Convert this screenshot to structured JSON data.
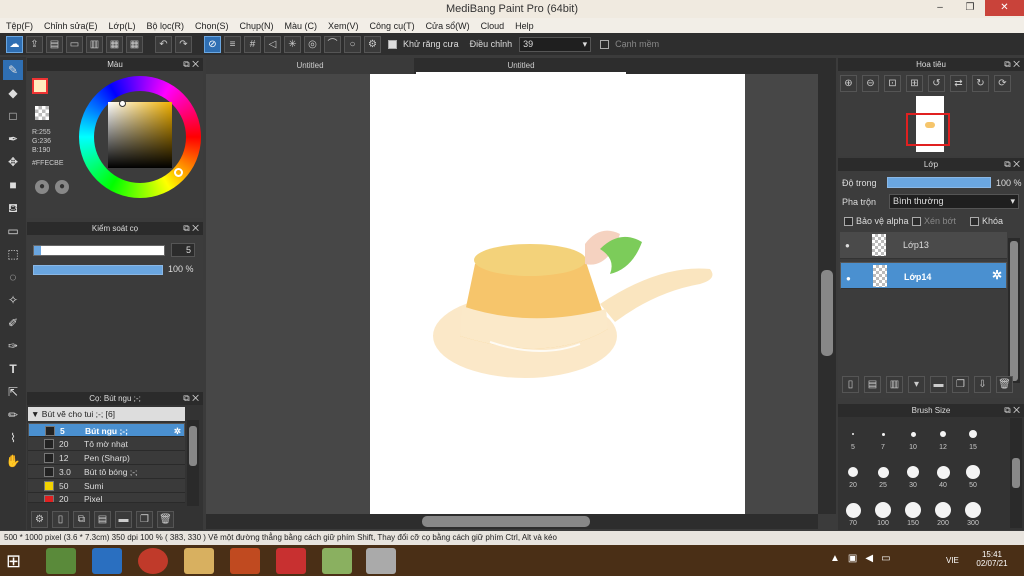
{
  "window": {
    "title": "MediBang Paint Pro (64bit)",
    "minimize": "–",
    "restore": "❐",
    "close": "✕"
  },
  "menu": [
    "Tệp(F)",
    "Chỉnh sửa(E)",
    "Lớp(L)",
    "Bộ lọc(R)",
    "Chọn(S)",
    "Chụp(N)",
    "Màu (C)",
    "Xem(V)",
    "Công cụ(T)",
    "Cửa sổ(W)",
    "Cloud",
    "Help"
  ],
  "toolbar": {
    "antialias_label": "Khử răng cưa",
    "correction_label": "Điều chỉnh",
    "correction_value": "39",
    "soft_edge_label": "Cạnh mềm"
  },
  "color_panel": {
    "title": "Màu",
    "r": "R:255",
    "g": "G:236",
    "b": "B:190",
    "hex": "#FFECBE"
  },
  "brush_control": {
    "title": "Kiểm soát cọ",
    "size": "5",
    "opacity": "100 %",
    "opacity_fraction": 1.0
  },
  "brush_panel": {
    "title": "Cọ: Bút ngu ;-;",
    "group": "Bút vẽ cho tui ;-; [6]",
    "items": [
      {
        "size": "5",
        "name": "Bút ngu ;-;",
        "color": "#222222",
        "selected": true
      },
      {
        "size": "20",
        "name": "Tô mờ nhạt",
        "color": "#222222",
        "selected": false
      },
      {
        "size": "12",
        "name": "Pen (Sharp)",
        "color": "#222222",
        "selected": false
      },
      {
        "size": "3.0",
        "name": "Bút tô bóng ;-;",
        "color": "#222222",
        "selected": false
      },
      {
        "size": "50",
        "name": "Sumi",
        "color": "#f2d200",
        "selected": false
      },
      {
        "size": "20",
        "name": "Pixel",
        "color": "#e02020",
        "selected": false
      }
    ]
  },
  "tabs": [
    "Untitled",
    "Untitled"
  ],
  "navigator": {
    "title": "Hoa tiêu"
  },
  "layer_panel": {
    "title": "Lớp",
    "opacity_label": "Độ trong",
    "opacity_value": "100 %",
    "opacity_fraction": 1.0,
    "blend_label": "Pha trộn",
    "blend_value": "Bình thường",
    "protect_alpha": "Bảo vệ alpha",
    "clipping": "Xén bớt",
    "lock": "Khóa",
    "layers": [
      {
        "name": "Lớp13",
        "selected": false
      },
      {
        "name": "Lớp14",
        "selected": true
      }
    ]
  },
  "brush_size": {
    "title": "Brush Size",
    "sizes": [
      "5",
      "7",
      "10",
      "12",
      "15",
      "20",
      "25",
      "30",
      "40",
      "50",
      "70",
      "100",
      "150",
      "200",
      "300"
    ]
  },
  "status": {
    "text": "500 * 1000 pixel   (3.6 * 7.3cm)   350 dpi   100 %   ( 383, 330 )   Vẽ một đường thẳng bằng cách giữ phím Shift, Thay đổi cỡ cọ bằng cách giữ phím Ctrl, Alt và kéo"
  },
  "taskbar": {
    "lang": "VIE",
    "time": "15:41",
    "date": "02/07/21"
  },
  "colors": {
    "accent": "#4a90d0",
    "close": "#c9433a",
    "taskbar": "#4a2f16"
  }
}
